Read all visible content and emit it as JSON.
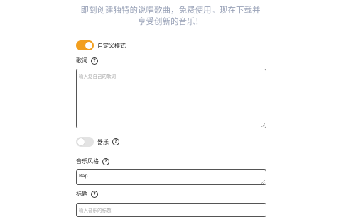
{
  "tagline": {
    "line1": "即刻创建独特的说唱歌曲，免费使用。现在下载并",
    "line2": "享受创新的音乐！"
  },
  "custom_mode": {
    "label": "自定义模式",
    "enabled": true
  },
  "lyrics": {
    "label": "歌词",
    "placeholder": "输入您自己的歌词"
  },
  "instrumental": {
    "label": "器乐",
    "enabled": false
  },
  "style": {
    "label": "音乐风格",
    "value": "Rap"
  },
  "title": {
    "label": "标题",
    "placeholder": "输入音乐的标题"
  },
  "colors": {
    "accent": "#f29f1f",
    "tagline": "#9aa3b8"
  },
  "icons": {
    "help": "question-circle-icon"
  }
}
